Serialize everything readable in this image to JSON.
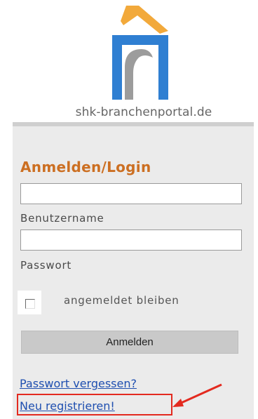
{
  "site": {
    "name": "shk-branchenportal.de"
  },
  "login": {
    "title": "Anmelden/Login",
    "username_value": "",
    "username_label": "Benutzername",
    "password_value": "",
    "password_label": "Passwort",
    "remember_label": "angemeldet bleiben",
    "remember_checked": false,
    "submit_label": "Anmelden",
    "forgot_link": "Passwort vergessen?",
    "register_link": "Neu registrieren!"
  },
  "colors": {
    "title": "#cc6f22",
    "link": "#1f4fb0",
    "annotation": "#e32a1f",
    "logo_orange": "#f2a93b",
    "logo_blue": "#2f7fd2"
  }
}
